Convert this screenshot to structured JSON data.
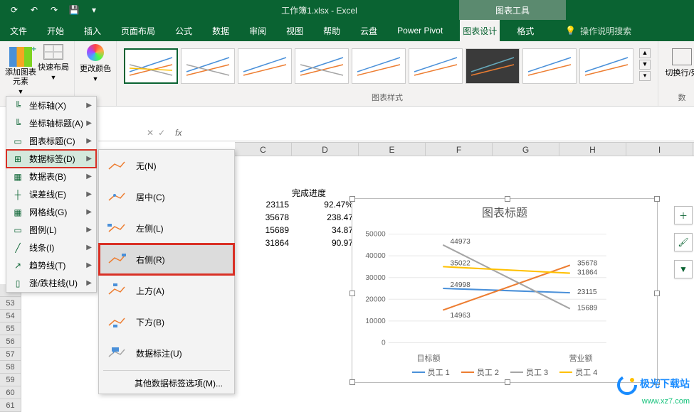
{
  "titlebar": {
    "doc": "工作簿1.xlsx  -  Excel",
    "contextual": "图表工具"
  },
  "tabs": {
    "file": "文件",
    "home": "开始",
    "insert": "插入",
    "layout": "页面布局",
    "formula": "公式",
    "data": "数据",
    "review": "审阅",
    "view": "视图",
    "help": "帮助",
    "cloud": "云盘",
    "pivot": "Power Pivot",
    "design": "图表设计",
    "format": "格式",
    "search": "操作说明搜索"
  },
  "ribbon": {
    "addElement": "添加图表元素",
    "quickLayout": "快速布局",
    "changeColor": "更改颜色",
    "stylesLabel": "图表样式",
    "switchRC": "切换行/列",
    "dataLabel": "数"
  },
  "menu1": {
    "axis": "坐标轴(X)",
    "axisTitle": "坐标轴标题(A)",
    "chartTitle": "图表标题(C)",
    "dataLabels": "数据标签(D)",
    "dataTable": "数据表(B)",
    "errorBars": "误差线(E)",
    "gridlines": "网格线(G)",
    "legend": "图例(L)",
    "lines": "线条(I)",
    "trendline": "趋势线(T)",
    "updown": "涨/跌柱线(U)"
  },
  "menu2": {
    "none": "无(N)",
    "center": "居中(C)",
    "left": "左侧(L)",
    "right": "右侧(R)",
    "above": "上方(A)",
    "below": "下方(B)",
    "callout": "数据标注(U)",
    "more": "其他数据标签选项(M)..."
  },
  "sheet": {
    "colC": "C",
    "colD": "D",
    "colE": "E",
    "colF": "F",
    "colG": "G",
    "colH": "H",
    "colI": "I",
    "hdr_progress": "完成进度",
    "r1c1": "23115",
    "r1c2": "92.47%",
    "r2c1": "35678",
    "r2c2": "238.47",
    "r3c1": "15689",
    "r3c2": "34.87",
    "r4c1": "31864",
    "r4c2": "90.97",
    "rows": [
      "52",
      "53",
      "54",
      "55",
      "56",
      "57",
      "58",
      "59",
      "60",
      "61"
    ]
  },
  "chart_data": {
    "type": "line",
    "title": "图表标题",
    "categories": [
      "目标额",
      "营业额"
    ],
    "ylim": [
      0,
      50000
    ],
    "yticks": [
      0,
      10000,
      20000,
      30000,
      40000,
      50000
    ],
    "series": [
      {
        "name": "员工 1",
        "color": "#4a90d9",
        "values": [
          24998,
          23115
        ]
      },
      {
        "name": "员工 2",
        "color": "#ed7d31",
        "values": [
          14963,
          35678
        ]
      },
      {
        "name": "员工 3",
        "color": "#a5a5a5",
        "values": [
          44973,
          15689
        ]
      },
      {
        "name": "员工 4",
        "color": "#ffc000",
        "values": [
          35022,
          31864
        ]
      }
    ],
    "right_labels": [
      "35678",
      "31864",
      "23115",
      "15689"
    ]
  },
  "watermark": {
    "l1": "极光下载站",
    "l2": "www.xz7.com"
  }
}
